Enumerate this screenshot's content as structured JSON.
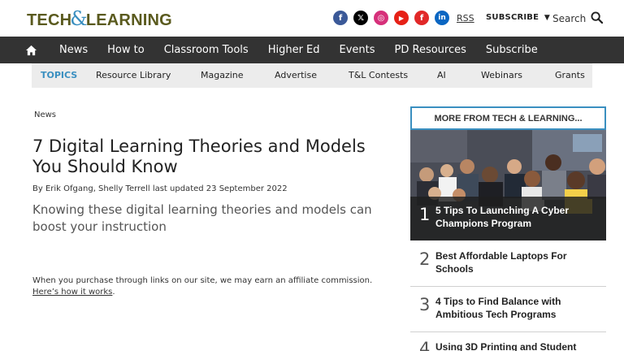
{
  "header": {
    "logo_left": "TECH",
    "logo_amp": "&",
    "logo_right": "LEARNING",
    "social": [
      {
        "name": "facebook-icon",
        "glyph": "f",
        "color": "#3b5998"
      },
      {
        "name": "x-icon",
        "glyph": "𝕏",
        "color": "#000000"
      },
      {
        "name": "instagram-icon",
        "glyph": "◎",
        "color": "#d6307a"
      },
      {
        "name": "youtube-icon",
        "glyph": "▶",
        "color": "#e62117"
      },
      {
        "name": "flipboard-icon",
        "glyph": "f",
        "color": "#e12828"
      },
      {
        "name": "linkedin-icon",
        "glyph": "in",
        "color": "#0a66c2"
      }
    ],
    "rss": "RSS",
    "subscribe": "SUBSCRIBE",
    "search": "Search"
  },
  "nav": {
    "items": [
      "News",
      "How to",
      "Classroom Tools",
      "Higher Ed",
      "Events",
      "PD Resources",
      "Subscribe"
    ]
  },
  "topics": {
    "label": "TOPICS",
    "items": [
      "Resource Library",
      "Magazine",
      "Advertise",
      "T&L Contests",
      "AI",
      "Webinars",
      "Grants"
    ]
  },
  "article": {
    "breadcrumb": "News",
    "title": "7 Digital Learning Theories and Models You Should Know",
    "byline": "By Erik Ofgang, Shelly Terrell last updated 23 September 2022",
    "standfirst": "Knowing these digital learning theories and models can boost your instruction",
    "affiliate_text": "When you purchase through links on our site, we may earn an affiliate commission.",
    "affiliate_link": "Here’s how it works",
    "affiliate_end": "."
  },
  "sidebar": {
    "heading": "MORE FROM TECH & LEARNING...",
    "items": [
      {
        "num": "1",
        "title": "5 Tips To Launching A Cyber Champions Program"
      },
      {
        "num": "2",
        "title": "Best Affordable Laptops For Schools"
      },
      {
        "num": "3",
        "title": "4 Tips to Find Balance with Ambitious Tech Programs"
      },
      {
        "num": "4",
        "title": "Using 3D Printing and Student"
      }
    ]
  },
  "colors": {
    "accent": "#3a8fc0",
    "nav_bg": "#333333",
    "topics_bg": "#ececec",
    "logo": "#5a5a1e"
  }
}
